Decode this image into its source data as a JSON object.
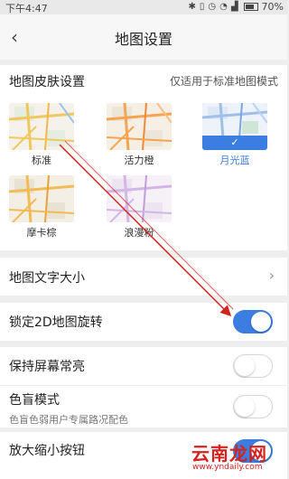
{
  "status_bar": {
    "time": "下午4:47",
    "battery": "70%",
    "icons": [
      "bluetooth-icon",
      "vibrate-icon",
      "alarm-icon",
      "wifi-icon",
      "signal-icon",
      "battery-icon"
    ]
  },
  "header": {
    "back_icon": "chevron-left-icon",
    "title": "地图设置"
  },
  "skin": {
    "title": "地图皮肤设置",
    "note": "仅适用于标准地图模式",
    "themes": [
      {
        "label": "标准",
        "selected": false,
        "color": "#f1c760"
      },
      {
        "label": "活力橙",
        "selected": false,
        "color": "#f5a451"
      },
      {
        "label": "月光蓝",
        "selected": true,
        "color": "#3b7de0"
      },
      {
        "label": "摩卡棕",
        "selected": false,
        "color": "#f3bb55"
      },
      {
        "label": "浪漫粉",
        "selected": false,
        "color": "#c8a8e0"
      }
    ],
    "check_mark": "✓"
  },
  "settings": {
    "font_size": {
      "label": "地图文字大小",
      "chevron": "›"
    },
    "lock_rotation": {
      "label": "锁定2D地图旋转",
      "on": true
    },
    "keep_screen_on": {
      "label": "保持屏幕常亮",
      "on": false
    },
    "color_blind": {
      "label": "色盲模式",
      "sub": "色盲色弱用户专属路况配色",
      "on": false
    },
    "zoom_buttons": {
      "label": "放大缩小按钮",
      "on": true
    }
  },
  "watermark": {
    "brand": "云南龙网",
    "url": "www.yndaily.com"
  },
  "colors": {
    "accent": "#3b7de0",
    "annotation": "#d2231f"
  }
}
